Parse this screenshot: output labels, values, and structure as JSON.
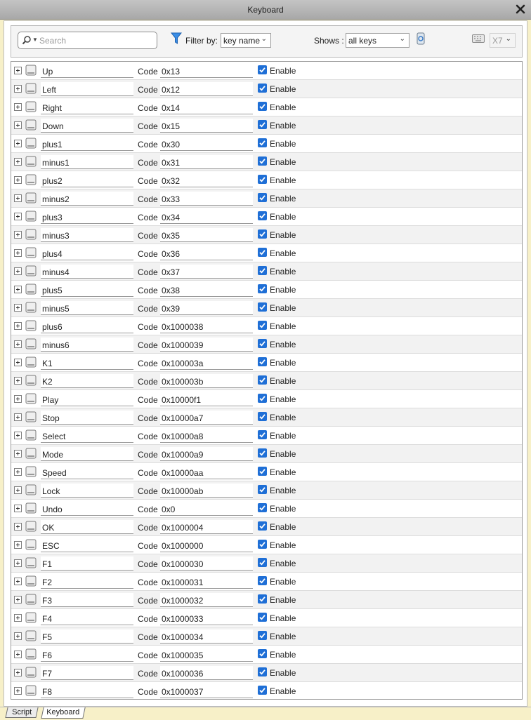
{
  "window": {
    "title": "Keyboard"
  },
  "toolbar": {
    "search_placeholder": "Search",
    "filter_label": "Filter by:",
    "filter_value": "key name",
    "shows_label": "Shows :",
    "shows_value": "all keys",
    "device_value": "X7"
  },
  "code_label": "Code",
  "enable_label": "Enable",
  "keys": [
    {
      "name": "Up",
      "code": "0x13",
      "enabled": true
    },
    {
      "name": "Left",
      "code": "0x12",
      "enabled": true
    },
    {
      "name": "Right",
      "code": "0x14",
      "enabled": true
    },
    {
      "name": "Down",
      "code": "0x15",
      "enabled": true
    },
    {
      "name": "plus1",
      "code": "0x30",
      "enabled": true
    },
    {
      "name": "minus1",
      "code": "0x31",
      "enabled": true
    },
    {
      "name": "plus2",
      "code": "0x32",
      "enabled": true
    },
    {
      "name": "minus2",
      "code": "0x33",
      "enabled": true
    },
    {
      "name": "plus3",
      "code": "0x34",
      "enabled": true
    },
    {
      "name": "minus3",
      "code": "0x35",
      "enabled": true
    },
    {
      "name": "plus4",
      "code": "0x36",
      "enabled": true
    },
    {
      "name": "minus4",
      "code": "0x37",
      "enabled": true
    },
    {
      "name": "plus5",
      "code": "0x38",
      "enabled": true
    },
    {
      "name": "minus5",
      "code": "0x39",
      "enabled": true
    },
    {
      "name": "plus6",
      "code": "0x1000038",
      "enabled": true
    },
    {
      "name": "minus6",
      "code": "0x1000039",
      "enabled": true
    },
    {
      "name": "K1",
      "code": "0x100003a",
      "enabled": true
    },
    {
      "name": "K2",
      "code": "0x100003b",
      "enabled": true
    },
    {
      "name": "Play",
      "code": "0x10000f1",
      "enabled": true
    },
    {
      "name": "Stop",
      "code": "0x10000a7",
      "enabled": true
    },
    {
      "name": "Select",
      "code": "0x10000a8",
      "enabled": true
    },
    {
      "name": "Mode",
      "code": "0x10000a9",
      "enabled": true
    },
    {
      "name": "Speed",
      "code": "0x10000aa",
      "enabled": true
    },
    {
      "name": "Lock",
      "code": "0x10000ab",
      "enabled": true
    },
    {
      "name": "Undo",
      "code": "0x0",
      "enabled": true
    },
    {
      "name": "OK",
      "code": "0x1000004",
      "enabled": true
    },
    {
      "name": "ESC",
      "code": "0x1000000",
      "enabled": true
    },
    {
      "name": "F1",
      "code": "0x1000030",
      "enabled": true
    },
    {
      "name": "F2",
      "code": "0x1000031",
      "enabled": true
    },
    {
      "name": "F3",
      "code": "0x1000032",
      "enabled": true
    },
    {
      "name": "F4",
      "code": "0x1000033",
      "enabled": true
    },
    {
      "name": "F5",
      "code": "0x1000034",
      "enabled": true
    },
    {
      "name": "F6",
      "code": "0x1000035",
      "enabled": true
    },
    {
      "name": "F7",
      "code": "0x1000036",
      "enabled": true
    },
    {
      "name": "F8",
      "code": "0x1000037",
      "enabled": true
    }
  ],
  "tabs": [
    {
      "label": "Script",
      "active": false
    },
    {
      "label": "Keyboard",
      "active": true
    }
  ],
  "colors": {
    "accent": "#1f6fd6",
    "row_alt": "#f2f2f2",
    "page_bg": "#f7f0c8"
  }
}
